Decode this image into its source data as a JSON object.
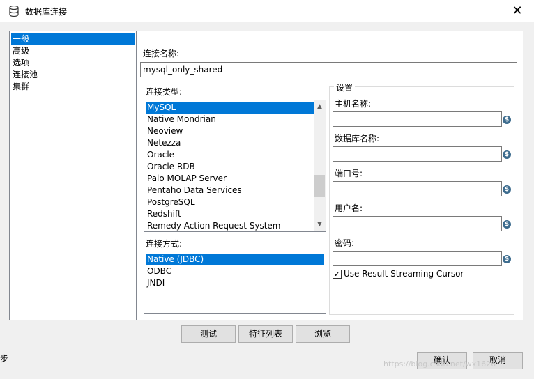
{
  "window": {
    "title": "数据库连接",
    "close": "✕"
  },
  "nav": {
    "items": [
      "一般",
      "高级",
      "选项",
      "连接池",
      "集群"
    ],
    "selected_index": 0
  },
  "connection_name": {
    "label": "连接名称:",
    "value": "mysql_only_shared"
  },
  "connection_type": {
    "label": "连接类型:",
    "items": [
      "MySQL",
      "Native Mondrian",
      "Neoview",
      "Netezza",
      "Oracle",
      "Oracle RDB",
      "Palo MOLAP Server",
      "Pentaho Data Services",
      "PostgreSQL",
      "Redshift",
      "Remedy Action Request System"
    ],
    "selected_index": 0
  },
  "access": {
    "label": "连接方式:",
    "items": [
      "Native (JDBC)",
      "ODBC",
      "JNDI"
    ],
    "selected_index": 0
  },
  "settings": {
    "title": "设置",
    "fields": [
      {
        "label": "主机名称:",
        "value": ""
      },
      {
        "label": "数据库名称:",
        "value": ""
      },
      {
        "label": "端口号:",
        "value": ""
      },
      {
        "label": "用户名:",
        "value": ""
      },
      {
        "label": "密码:",
        "value": ""
      }
    ],
    "var_icon": "$",
    "streaming_cursor": {
      "label": "Use Result Streaming Cursor",
      "checked": true,
      "mark": "✓"
    }
  },
  "buttons": {
    "test": "测试",
    "features": "特征列表",
    "browse": "浏览",
    "ok": "确认",
    "cancel": "取消"
  },
  "watermark": "https://blog.csdn.net/wx1626",
  "left_fragment": "步"
}
